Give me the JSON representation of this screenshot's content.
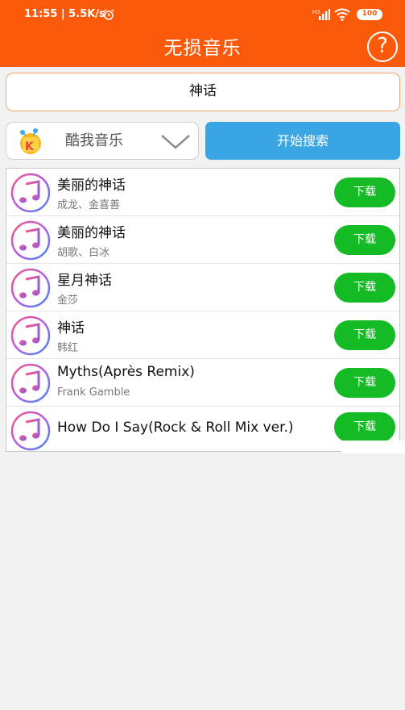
{
  "status_bar": {
    "time": "11:55 | 5.5K/s",
    "battery": "100"
  },
  "header": {
    "title": "无损音乐",
    "help_label": "?"
  },
  "search": {
    "value": "神话"
  },
  "source": {
    "label": "酷我音乐"
  },
  "search_button": {
    "label": "开始搜索"
  },
  "songs": [
    {
      "title": "美丽的神话",
      "artist": "成龙、金喜善",
      "download_label": "下载"
    },
    {
      "title": "美丽的神话",
      "artist": "胡歌、白冰",
      "download_label": "下载"
    },
    {
      "title": "星月神话",
      "artist": "金莎",
      "download_label": "下载"
    },
    {
      "title": "神话",
      "artist": "韩红",
      "download_label": "下载"
    },
    {
      "title": "Myths(Après Remix)",
      "artist": "Frank Gamble",
      "download_label": "下载"
    },
    {
      "title": "How Do I Say(Rock & Roll Mix ver.)",
      "artist": "",
      "download_label": "下载"
    }
  ],
  "colors": {
    "header": "#fb5a0a",
    "search_button": "#3aa6e4",
    "download_button": "#15bb24"
  }
}
